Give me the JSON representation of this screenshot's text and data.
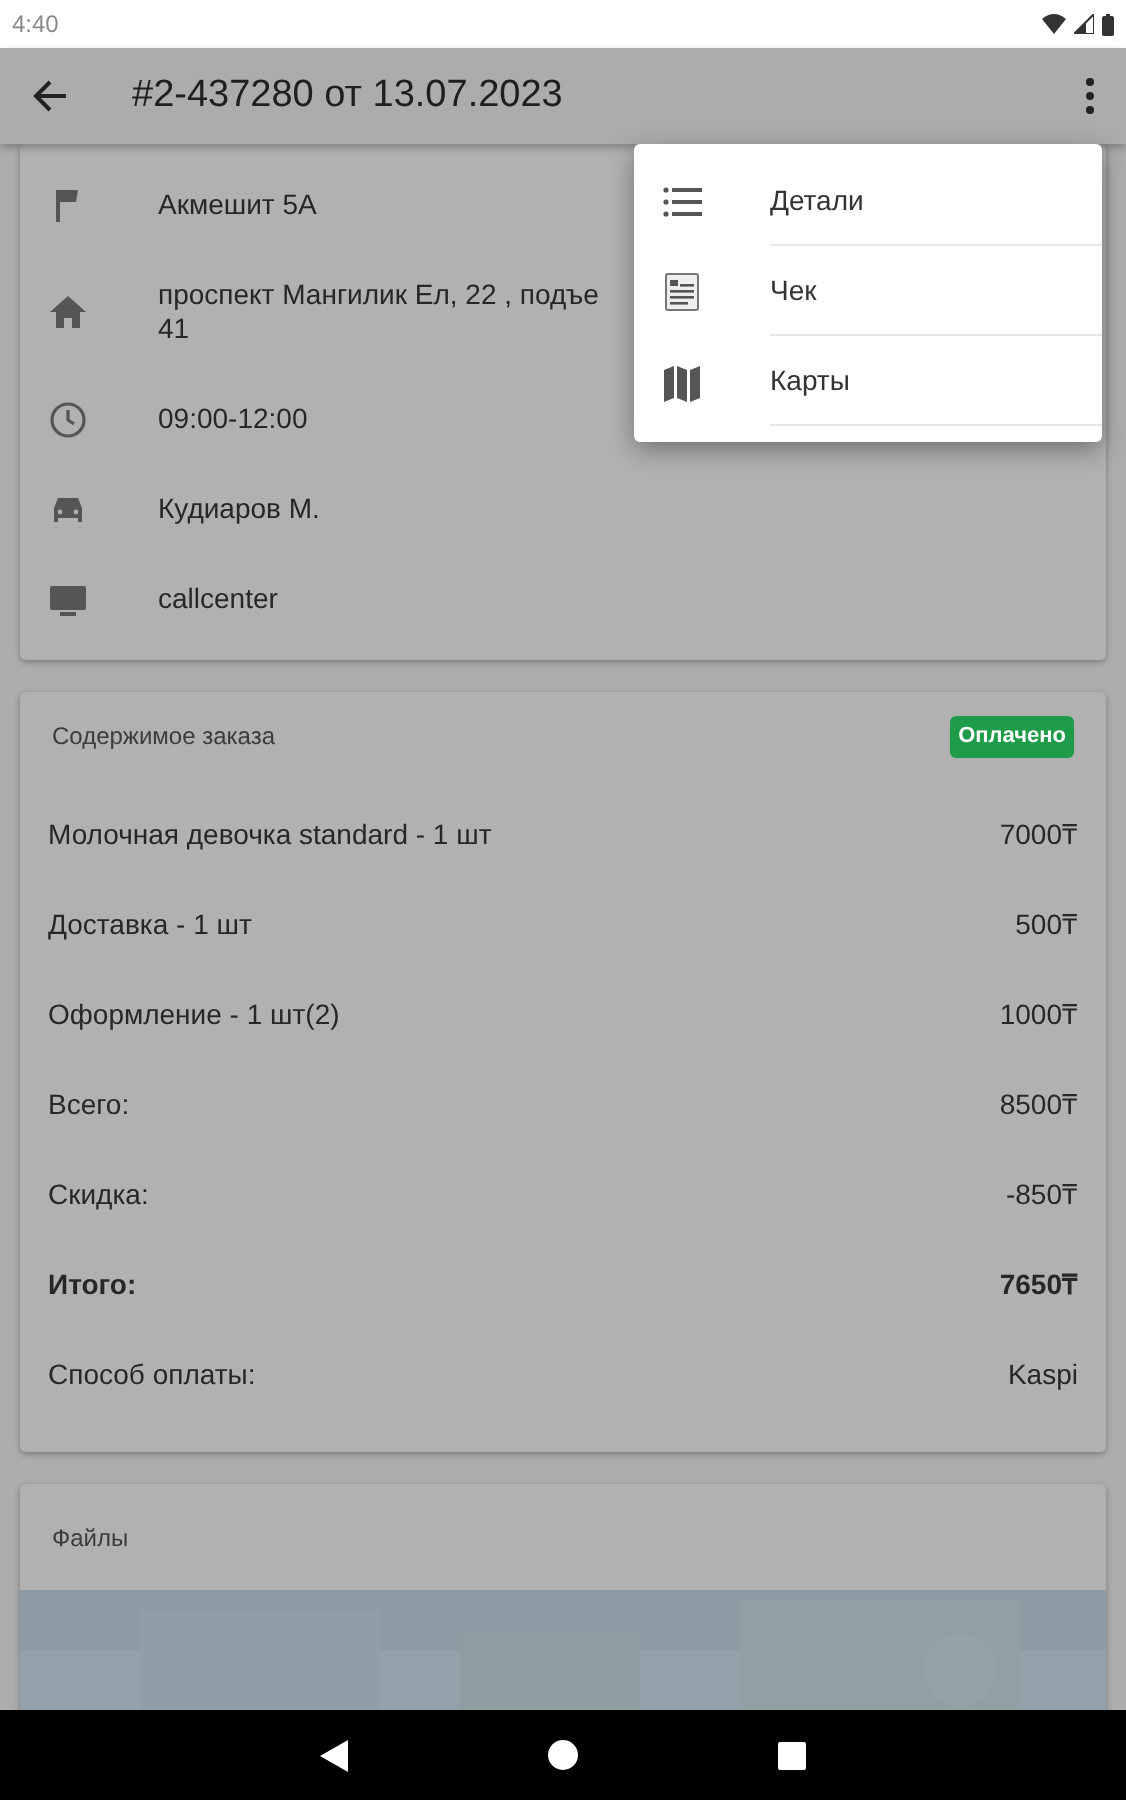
{
  "status_bar": {
    "time": "4:40"
  },
  "app_bar": {
    "title": "#2-437280 от 13.07.2023"
  },
  "info": [
    {
      "kind": "flag",
      "lines": [
        "Акмешит 5А"
      ]
    },
    {
      "kind": "home",
      "lines": [
        "проспект Мангилик Ел, 22 , подъе",
        "41"
      ]
    },
    {
      "kind": "clock",
      "lines": [
        "09:00-12:00"
      ]
    },
    {
      "kind": "car",
      "lines": [
        "Кудиаров М."
      ]
    },
    {
      "kind": "monitor",
      "lines": [
        "callcenter"
      ]
    }
  ],
  "order": {
    "title": "Содержимое заказа",
    "status": "Оплачено",
    "lines": [
      {
        "label": "Молочная девочка standard - 1 шт",
        "value": "7000₸",
        "bold": false
      },
      {
        "label": "Доставка - 1 шт",
        "value": "500₸",
        "bold": false
      },
      {
        "label": "Оформление - 1 шт(2)",
        "value": "1000₸",
        "bold": false
      },
      {
        "label": "Всего:",
        "value": "8500₸",
        "bold": false
      },
      {
        "label": "Скидка:",
        "value": "-850₸",
        "bold": false
      },
      {
        "label": "Итого:",
        "value": "7650₸",
        "bold": true
      },
      {
        "label": "Способ оплаты:",
        "value": "Kaspi",
        "bold": false
      }
    ]
  },
  "files": {
    "title": "Файлы"
  },
  "menu": [
    {
      "kind": "list",
      "label": "Детали"
    },
    {
      "kind": "receipt",
      "label": "Чек"
    },
    {
      "kind": "map",
      "label": "Карты"
    }
  ]
}
